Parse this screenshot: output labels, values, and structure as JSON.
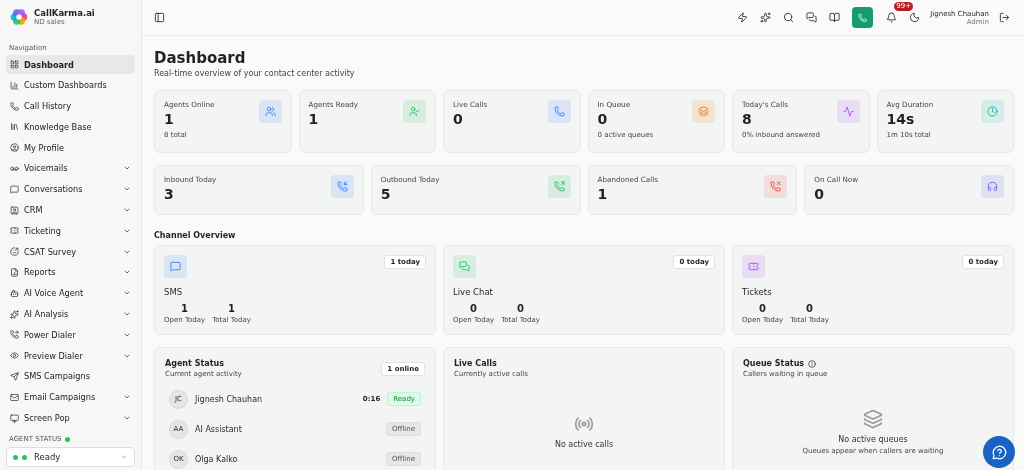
{
  "brand": {
    "name": "CallKarma.ai",
    "subtitle": "ND sales"
  },
  "sidebar": {
    "section": "Navigation",
    "items": [
      {
        "label": "Dashboard",
        "selected": true,
        "expandable": false
      },
      {
        "label": "Custom Dashboards",
        "selected": false,
        "expandable": false
      },
      {
        "label": "Call History",
        "selected": false,
        "expandable": false
      },
      {
        "label": "Knowledge Base",
        "selected": false,
        "expandable": false
      },
      {
        "label": "My Profile",
        "selected": false,
        "expandable": false
      },
      {
        "label": "Voicemails",
        "selected": false,
        "expandable": true
      },
      {
        "label": "Conversations",
        "selected": false,
        "expandable": true
      },
      {
        "label": "CRM",
        "selected": false,
        "expandable": true
      },
      {
        "label": "Ticketing",
        "selected": false,
        "expandable": true
      },
      {
        "label": "CSAT Survey",
        "selected": false,
        "expandable": true
      },
      {
        "label": "Reports",
        "selected": false,
        "expandable": true
      },
      {
        "label": "AI Voice Agent",
        "selected": false,
        "expandable": true
      },
      {
        "label": "AI Analysis",
        "selected": false,
        "expandable": true
      },
      {
        "label": "Power Dialer",
        "selected": false,
        "expandable": true
      },
      {
        "label": "Preview Dialer",
        "selected": false,
        "expandable": true
      },
      {
        "label": "SMS Campaigns",
        "selected": false,
        "expandable": false
      },
      {
        "label": "Email Campaigns",
        "selected": false,
        "expandable": true
      },
      {
        "label": "Screen Pop",
        "selected": false,
        "expandable": true
      }
    ],
    "agent_status": {
      "label": "AGENT STATUS",
      "color": "#22c55e",
      "value": "Ready"
    }
  },
  "header": {
    "notifications": "99+",
    "user": {
      "name": "Jignesh Chauhan",
      "role": "Admin"
    }
  },
  "page": {
    "title": "Dashboard",
    "subtitle": "Real-time overview of your contact center activity"
  },
  "stats_row_1": [
    {
      "label": "Agents Online",
      "value": "1",
      "note": "8 total"
    },
    {
      "label": "Agents Ready",
      "value": "1"
    },
    {
      "label": "Live Calls",
      "value": "0"
    },
    {
      "label": "In Queue",
      "value": "0",
      "note": "0 active queues"
    },
    {
      "label": "Today's Calls",
      "value": "8",
      "note": "0% inbound answered"
    },
    {
      "label": "Avg Duration",
      "value": "14s",
      "note": "1m 10s total"
    }
  ],
  "stats_row_2": [
    {
      "label": "Inbound Today",
      "value": "3"
    },
    {
      "label": "Outbound Today",
      "value": "5"
    },
    {
      "label": "Abandoned Calls",
      "value": "1"
    },
    {
      "label": "On Call Now",
      "value": "0"
    }
  ],
  "channel_overview": {
    "title": "Channel Overview",
    "channels": [
      {
        "name": "SMS",
        "badge": "1 today",
        "open": "1",
        "open_label": "Open Today",
        "total": "1",
        "total_label": "Total Today"
      },
      {
        "name": "Live Chat",
        "badge": "0 today",
        "open": "0",
        "open_label": "Open Today",
        "total": "0",
        "total_label": "Total Today"
      },
      {
        "name": "Tickets",
        "badge": "0 today",
        "open": "0",
        "open_label": "Open Today",
        "total": "0",
        "total_label": "Total Today"
      }
    ]
  },
  "agent_status_panel": {
    "title": "Agent Status",
    "subtitle": "Current agent activity",
    "badge": "1 online",
    "agents": [
      {
        "initials": "JC",
        "name": "Jignesh Chauhan",
        "time": "0:16",
        "status": "Ready",
        "kind": "ready"
      },
      {
        "initials": "AA",
        "name": "AI Assistant",
        "status": "Offline",
        "kind": "offline"
      },
      {
        "initials": "OK",
        "name": "Olga Kalko",
        "status": "Offline",
        "kind": "offline"
      }
    ]
  },
  "live_calls_panel": {
    "title": "Live Calls",
    "subtitle": "Currently active calls",
    "empty": "No active calls"
  },
  "queue_status_panel": {
    "title": "Queue Status",
    "subtitle": "Callers waiting in queue",
    "empty": "No active queues",
    "hint": "Queues appear when callers are waiting"
  }
}
